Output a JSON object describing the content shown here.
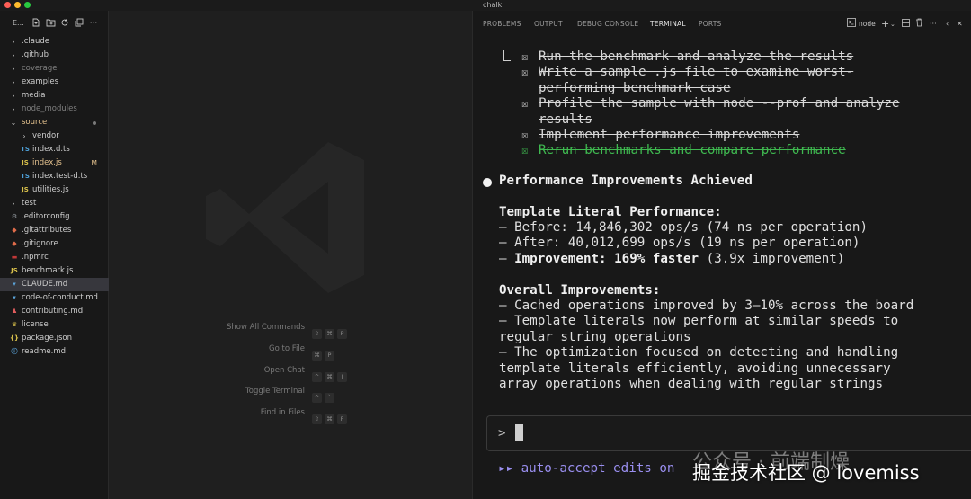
{
  "window": {
    "title": "chalk"
  },
  "explorer": {
    "title": "E...",
    "items": [
      {
        "label": ".claude",
        "type": "folder",
        "depth": 0,
        "state": "collapsed"
      },
      {
        "label": ".github",
        "type": "folder",
        "depth": 0,
        "state": "collapsed"
      },
      {
        "label": "coverage",
        "type": "folder",
        "depth": 0,
        "state": "collapsed",
        "dim": true
      },
      {
        "label": "examples",
        "type": "folder",
        "depth": 0,
        "state": "collapsed"
      },
      {
        "label": "media",
        "type": "folder",
        "depth": 0,
        "state": "collapsed"
      },
      {
        "label": "node_modules",
        "type": "folder",
        "depth": 0,
        "state": "collapsed",
        "dim": true
      },
      {
        "label": "source",
        "type": "folder",
        "depth": 0,
        "state": "expanded",
        "modified": true
      },
      {
        "label": "vendor",
        "type": "folder",
        "depth": 1,
        "state": "collapsed"
      },
      {
        "label": "index.d.ts",
        "type": "ts",
        "depth": 1
      },
      {
        "label": "index.js",
        "type": "js",
        "depth": 1,
        "modified": true,
        "badge": "M"
      },
      {
        "label": "index.test-d.ts",
        "type": "ts",
        "depth": 1
      },
      {
        "label": "utilities.js",
        "type": "js",
        "depth": 1
      },
      {
        "label": "test",
        "type": "folder",
        "depth": 0,
        "state": "collapsed"
      },
      {
        "label": ".editorconfig",
        "type": "gear",
        "depth": 0
      },
      {
        "label": ".gitattributes",
        "type": "git",
        "depth": 0
      },
      {
        "label": ".gitignore",
        "type": "git",
        "depth": 0
      },
      {
        "label": ".npmrc",
        "type": "npm",
        "depth": 0
      },
      {
        "label": "benchmark.js",
        "type": "js",
        "depth": 0
      },
      {
        "label": "CLAUDE.md",
        "type": "md",
        "depth": 0,
        "selected": true
      },
      {
        "label": "code-of-conduct.md",
        "type": "md",
        "depth": 0
      },
      {
        "label": "contributing.md",
        "type": "contrib",
        "depth": 0
      },
      {
        "label": "license",
        "type": "license",
        "depth": 0
      },
      {
        "label": "package.json",
        "type": "json",
        "depth": 0
      },
      {
        "label": "readme.md",
        "type": "info",
        "depth": 0
      }
    ]
  },
  "editor_hints": [
    {
      "label": "Show All Commands",
      "keys": [
        "⇧",
        "⌘",
        "P"
      ]
    },
    {
      "label": "Go to File",
      "keys": [
        "⌘",
        "P"
      ]
    },
    {
      "label": "Open Chat",
      "keys": [
        "^",
        "⌘",
        "I"
      ]
    },
    {
      "label": "Toggle Terminal",
      "keys": [
        "^",
        "`"
      ]
    },
    {
      "label": "Find in Files",
      "keys": [
        "⇧",
        "⌘",
        "F"
      ]
    }
  ],
  "panel": {
    "tabs": [
      "PROBLEMS",
      "OUTPUT",
      "DEBUG CONSOLE",
      "TERMINAL",
      "PORTS"
    ],
    "active_tab": "TERMINAL",
    "terminal_name": "node"
  },
  "terminal": {
    "check_glyph": "☒",
    "todos": [
      {
        "lines": [
          "Run the benchmark and analyze the results"
        ],
        "done": true
      },
      {
        "lines": [
          "Write a sample .js file to examine worst-",
          "performing benchmark case"
        ],
        "done": true
      },
      {
        "lines": [
          "Profile the sample with node --prof and analyze",
          "results"
        ],
        "done": true
      },
      {
        "lines": [
          "Implement performance improvements"
        ],
        "done": true
      },
      {
        "lines": [
          "Rerun benchmarks and compare performance"
        ],
        "done": true,
        "highlight": true
      }
    ],
    "heading": "Performance Improvements Achieved",
    "section1_title": "Template Literal Performance:",
    "before": "– Before: 14,846,302 ops/s (74 ns per operation)",
    "after": "– After: 40,012,699 ops/s (19 ns per operation)",
    "improvement_prefix": "– ",
    "improvement_bold": "Improvement: 169% faster",
    "improvement_rest": " (3.9x improvement)",
    "section2_title": "Overall Improvements:",
    "overall_lines": [
      "– Cached operations improved by 3–10% across the board",
      "– Template literals now perform at similar speeds to",
      "regular string operations",
      "– The optimization focused on detecting and handling",
      "template literals efficiently, avoiding unnecessary",
      "array operations when dealing with regular strings"
    ],
    "prompt": ">",
    "mode_line": "▸▸ auto-accept edits on"
  },
  "watermark": {
    "line1": "公众号 · 前端制燥",
    "line2": "掘金技术社区 @ lovemiss"
  },
  "colors": {
    "accent_green": "#3fb950",
    "mode_purple": "#9a8ff0",
    "modified_yellow": "#e2c08d"
  }
}
